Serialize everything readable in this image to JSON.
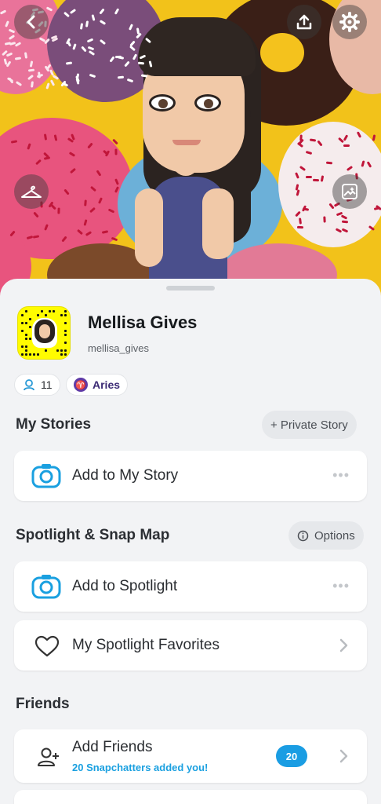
{
  "profile": {
    "display_name": "Mellisa Gives",
    "username": "mellisa_gives",
    "friends_count": "11",
    "zodiac": "Aries",
    "zodiac_symbol": "♈"
  },
  "header": {
    "back_icon": "chevron-left-icon",
    "share_icon": "upload-icon",
    "settings_icon": "gear-icon",
    "outfit_icon": "hanger-icon",
    "background_icon": "image-sparkle-icon"
  },
  "sections": {
    "my_stories": {
      "title": "My Stories",
      "action_label": "+ Private Story",
      "add_label": "Add to My Story",
      "more": "•••"
    },
    "spotlight": {
      "title": "Spotlight & Snap Map",
      "action_label": "Options",
      "add_label": "Add to Spotlight",
      "favorites_label": "My Spotlight Favorites",
      "more": "•••"
    },
    "friends": {
      "title": "Friends",
      "add_label": "Add Friends",
      "added_you": "20 Snapchatters added you!",
      "badge": "20"
    }
  },
  "colors": {
    "accent_blue": "#1aa0e0",
    "snapcode_yellow": "#fffc00",
    "zodiac_purple": "#5f3aa6"
  }
}
